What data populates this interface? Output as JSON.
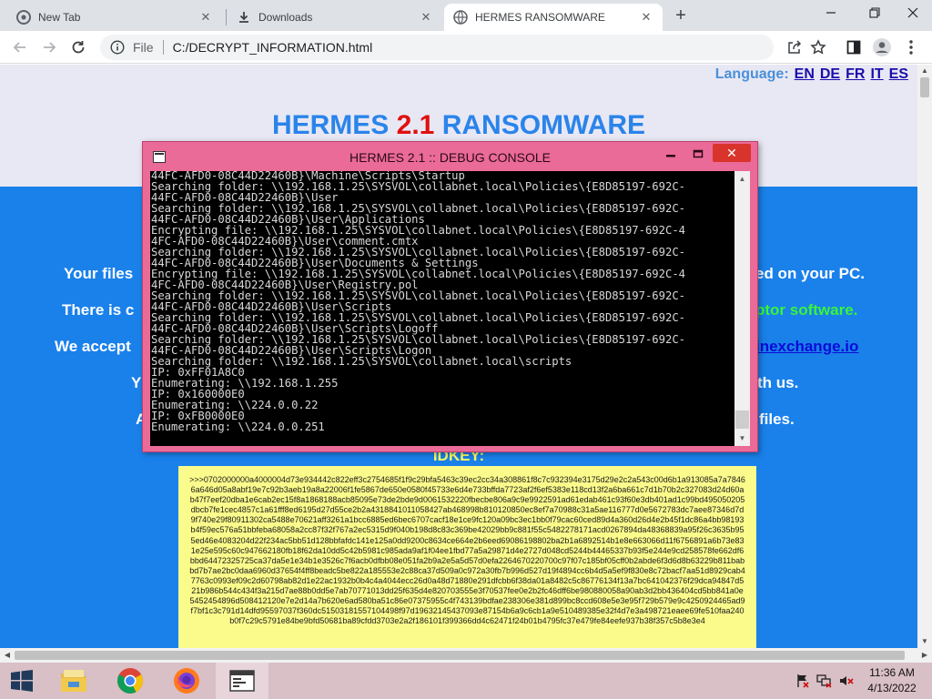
{
  "browser": {
    "tabs": [
      {
        "title": "New Tab",
        "icon": "chrome-icon"
      },
      {
        "title": "Downloads",
        "icon": "download-icon"
      },
      {
        "title": "HERMES RANSOMWARE",
        "icon": "globe-icon",
        "active": true
      }
    ],
    "address": {
      "scheme": "File",
      "path": "C:/DECRYPT_INFORMATION.html"
    }
  },
  "page": {
    "language_label": "Language:",
    "languages": [
      "EN",
      "DE",
      "FR",
      "IT",
      "ES"
    ],
    "title_left": "HERMES",
    "title_version": "2.1",
    "title_right": "RANSOMWARE",
    "lines": [
      {
        "a": "Your files",
        "b": "ed on your PC."
      },
      {
        "a": "There is  c",
        "b": "ptor software."
      },
      {
        "a": "We accept",
        "b": "inexchange.io"
      },
      {
        "a": "Y",
        "b": "th us."
      },
      {
        "a": "A",
        "b": "files."
      }
    ],
    "idkey_label": "IDKEY:",
    "idkey_text": ">>>0702000000a4000004d73e934442c822eff3c2754685f1f9c29bfa5463c39ec2cc34a308861f8c7c932394e3175d29e2c2a543c00d6b1a913085a7a78466a646d05a8abf19e7c92b3aeb19a8a22006f1fe5867de650e0580f45733e6d4e733bffda7723af2f6ef5383e118cd13f2a6ba661c7d1b70b2c327083d24d60ab47f7eef20dba1e6cab2ec15f8a1868188acb85095e73de2bde9d0061532220fbecbe806a9c9e9922591ad61edab461c93f60e3db401ad1c99bd495050205dbcb7fe1cec4857c1a61fff8ed6195d27d55ce2b2a4318841011058427ab468998b810120850ec8ef7a70988c31a5ae116777d0e5672783dc7aee87346d7d9f740e29f80911302ca5488e70621aff3261a1bcc6885ed6bec6707cacf18e1ce9fc120a09bc3ec1bb0f79cac60ced89d4a360d26d4e2b45f1dc86a4bb98193b4f59ec576a51bbfeba68058a2cc87f32f767a2ec5315d9f040b198d8c83c369be42029bb9c881f55c5482278171acd0267894da48368839a95f26c3635b955ed46e4083204d22f234ac5bb51d128bbfafdc141e125a0dd9200c8634ce664e2b6eed69086198802ba2b1a6892514b1e8e663066d11f6756891a6b73e831e25e595c60c947662180fb18f62da10dd5c42b5981c985ada9af1f04ee1fbd77a5a29871d4e2727d048cd5244b44465337b93f5e244e9cd258578fe662df6bbd64472325725ca37da5e1e34b1e3526c7f6acb0dfbb08e051fa2b9a2e5a5d57d0efa2264670220700c97f07c185bf05cff0b2abde6f3d6d8b63229b811babbd7b7ae2bc0daa6960d37654f4ff8beadc5be822a185553e2c88ca37d509a0c972a30fb7b996d527d19f4894cc6b4d5a5ef9f830e8c72bacf7aa51d8929cab47763c0993ef09c2d60798ab82d1e22ac1932b0b4c4a4044ecc26d0a48d71880e291dfcbb6f38da01a8482c5c86776134f13a7bc641042376f29dca94847d521b986b544c434f3a215d7ae88b0dd5e7ab70771013dd25f635d4e820703555e3f70537fee0e2b2fc46dff6be980880058a90ab3d2bb436404cd5bb841a0e5452454896d508412120e7e2d14a7b620e6ad580ba51c86e07375955c4f743139bdfae238306e381d899bc8ccd608e5e3e95f729b579e9c4250924465ad9f7bf1c3c791d14dfd95597037f360dc51503181557104498f97d19632145437093e87154b6a9c6cb1a9e510489385e32f4d7e3a498721eaee69fe510faa240b0f7c29c5791e84be9bfd50681ba89cfdd3703e2a2f186101f399366dd4c62471f24b01b4795fc37e479fe84eefe937b38f357c5b8e3e4"
  },
  "console": {
    "title": "HERMES 2.1 :: DEBUG CONSOLE",
    "text": "44FC-AFD0-08C44D22460B}\\Machine\\Scripts\\Startup\nSearching folder: \\\\192.168.1.25\\SYSVOL\\collabnet.local\\Policies\\{E8D85197-692C-\n44FC-AFD0-08C44D22460B}\\User\nSearching folder: \\\\192.168.1.25\\SYSVOL\\collabnet.local\\Policies\\{E8D85197-692C-\n44FC-AFD0-08C44D22460B}\\User\\Applications\nEncrypting file: \\\\192.168.1.25\\SYSVOL\\collabnet.local\\Policies\\{E8D85197-692C-4\n4FC-AFD0-08C44D22460B}\\User\\comment.cmtx\nSearching folder: \\\\192.168.1.25\\SYSVOL\\collabnet.local\\Policies\\{E8D85197-692C-\n44FC-AFD0-08C44D22460B}\\User\\Documents & Settings\nEncrypting file: \\\\192.168.1.25\\SYSVOL\\collabnet.local\\Policies\\{E8D85197-692C-4\n4FC-AFD0-08C44D22460B}\\User\\Registry.pol\nSearching folder: \\\\192.168.1.25\\SYSVOL\\collabnet.local\\Policies\\{E8D85197-692C-\n44FC-AFD0-08C44D22460B}\\User\\Scripts\nSearching folder: \\\\192.168.1.25\\SYSVOL\\collabnet.local\\Policies\\{E8D85197-692C-\n44FC-AFD0-08C44D22460B}\\User\\Scripts\\Logoff\nSearching folder: \\\\192.168.1.25\\SYSVOL\\collabnet.local\\Policies\\{E8D85197-692C-\n44FC-AFD0-08C44D22460B}\\User\\Scripts\\Logon\nSearching folder: \\\\192.168.1.25\\SYSVOL\\collabnet.local\\scripts\nIP: 0xFF01A8C0\nEnumerating: \\\\192.168.1.255\nIP: 0x160000E0\nEnumerating: \\\\224.0.0.22\nIP: 0xFB0000E0\nEnumerating: \\\\224.0.0.251"
  },
  "taskbar": {
    "apps": [
      "file-explorer-icon",
      "chrome-icon",
      "firefox-icon",
      "console-app-icon"
    ],
    "time": "11:36 AM",
    "date": "4/13/2022"
  }
}
